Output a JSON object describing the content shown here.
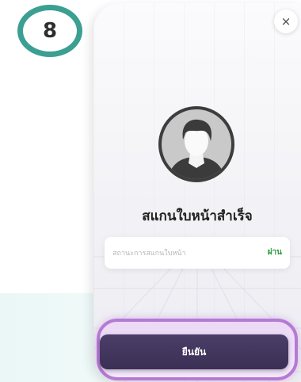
{
  "step": {
    "number": "8",
    "accent_color": "#3b9f91"
  },
  "screen": {
    "close_icon": "×",
    "avatar_icon": "user-silhouette",
    "title": "สแกนใบหน้าสำเร็จ",
    "status": {
      "label": "สถานะการสแกนใบหน้า",
      "value": "ผ่าน",
      "value_color": "#2e9b3e"
    },
    "confirm_button": {
      "label": "ยืนยัน",
      "color": "#3a2f54",
      "highlight_color": "#b57ad3"
    }
  }
}
